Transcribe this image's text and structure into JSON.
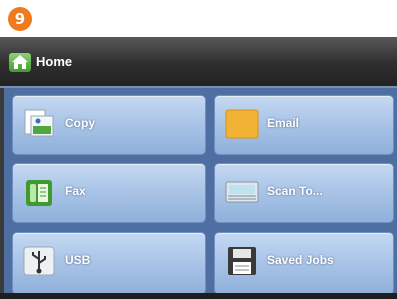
{
  "step_badge": "9",
  "titlebar": {
    "label": "Home",
    "icon": "home-icon"
  },
  "tiles": [
    {
      "label": "Copy",
      "icon": "copy-icon"
    },
    {
      "label": "Email",
      "icon": "email-icon"
    },
    {
      "label": "Fax",
      "icon": "fax-icon"
    },
    {
      "label": "Scan To...",
      "icon": "scan-icon"
    },
    {
      "label": "USB",
      "icon": "usb-icon"
    },
    {
      "label": "Saved Jobs",
      "icon": "saved-jobs-icon"
    }
  ],
  "colors": {
    "badge": "#f07a1e",
    "titlebar": "#2e2e2e",
    "panel": "#4f6fa2",
    "tile": "#a8c3e6"
  }
}
